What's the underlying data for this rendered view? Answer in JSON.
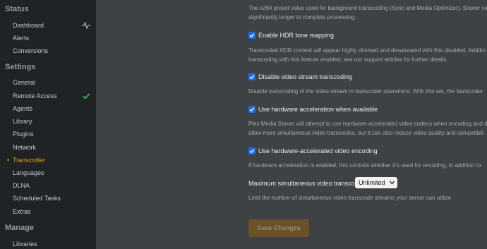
{
  "sidebar": {
    "sections": {
      "status": "Status",
      "settings": "Settings",
      "manage": "Manage"
    },
    "status_items": [
      {
        "label": "Dashboard"
      },
      {
        "label": "Alerts"
      },
      {
        "label": "Conversions"
      }
    ],
    "settings_items": [
      {
        "label": "General"
      },
      {
        "label": "Remote Access"
      },
      {
        "label": "Agents"
      },
      {
        "label": "Library"
      },
      {
        "label": "Plugins"
      },
      {
        "label": "Network"
      },
      {
        "label": "Transcoder"
      },
      {
        "label": "Languages"
      },
      {
        "label": "DLNA"
      },
      {
        "label": "Scheduled Tasks"
      },
      {
        "label": "Extras"
      }
    ],
    "manage_items": [
      {
        "label": "Libraries"
      }
    ],
    "active_item": "Transcoder",
    "icons": {
      "dashboard": "activity-pulse-icon",
      "remote_access": "check-icon"
    },
    "colors": {
      "accent": "#e5a00d",
      "success": "#4cc35d"
    }
  },
  "main": {
    "preset_desc_line1": "The x264 preset value used for background transcoding (Sync and Media Optimizer). Slower va",
    "preset_desc_line2": "significantly longer to complete processing.",
    "hdr": {
      "label": "Enable HDR tone mapping",
      "checked": true,
      "desc_line1": "Transcoded HDR content will appear highly dimmed and desaturated with this disabled. Additio",
      "desc_line2": "transcoding with this feature enabled; see our support articles for further details."
    },
    "disable_video": {
      "label": "Disable video stream transcoding",
      "checked": true,
      "desc_line1": "Disable transcoding of the video stream in transcoder operations. With this set, the transcoder"
    },
    "hw_accel": {
      "label": "Use hardware acceleration when available",
      "checked": true,
      "desc_line1": "Plex Media Server will attempt to use hardware-accelerated video codecs when encoding and d",
      "desc_line2": "allow more simultaneous video transcodes, but it can also reduce video quality and compatibili"
    },
    "hw_encoding": {
      "label": "Use hardware-accelerated video encoding",
      "checked": true,
      "desc_line1": "If hardware acceleration is enabled, this controls whether it's used for encoding, in addition to"
    },
    "max_transcode": {
      "label": "Maximum simultaneous video transcode",
      "value": "Unlimited",
      "desc": "Limit the number of simultaneous video transcode streams your server can utilize"
    },
    "save_label": "Save Changes",
    "colors": {
      "checkbox": "#1a6ee6",
      "save_button": "#6b5126"
    }
  }
}
